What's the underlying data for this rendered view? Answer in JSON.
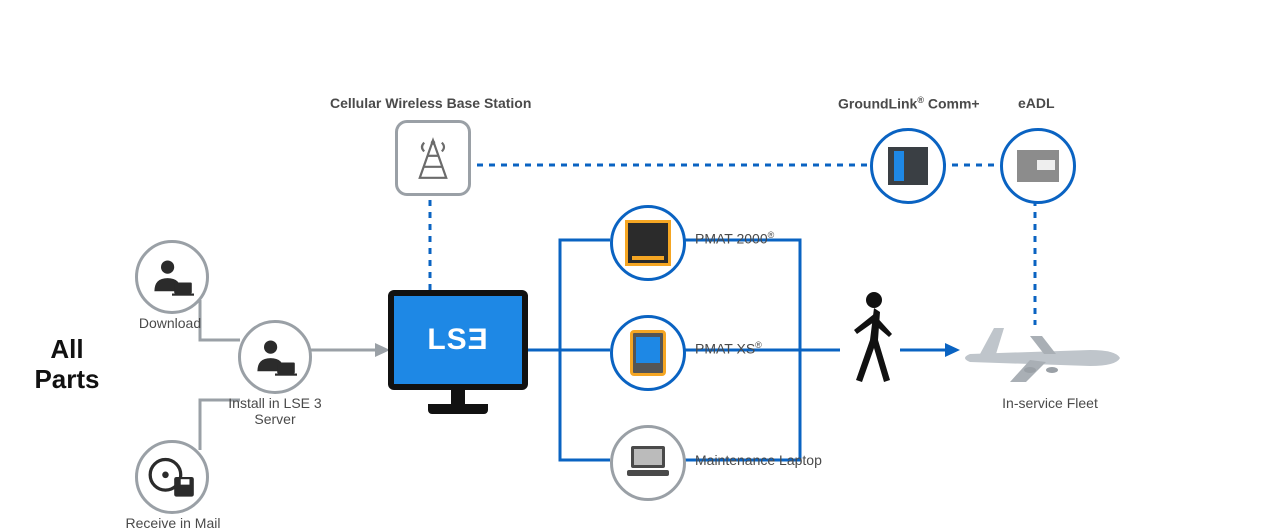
{
  "title": {
    "line1": "All",
    "line2": "Parts"
  },
  "nodes": {
    "download": "Download",
    "install": "Install in LSE 3\nServer",
    "receive": "Receive in Mail",
    "cell": "Cellular Wireless Base Station",
    "lse_logo": "LSƎ",
    "pmat2000": "PMAT 2000",
    "pmat2000_mark": "®",
    "pmatxs": "PMAT XS",
    "pmatxs_mark": "®",
    "mlaptop": "Maintenance Laptop",
    "gcomm": "GroundLink",
    "gcomm_mark": "®",
    "gcomm_suffix": " Comm+",
    "eadl": "eADL",
    "fleet": "In-service Fleet"
  },
  "colors": {
    "blue": "#0a63c2",
    "gray": "#9aa0a6"
  }
}
